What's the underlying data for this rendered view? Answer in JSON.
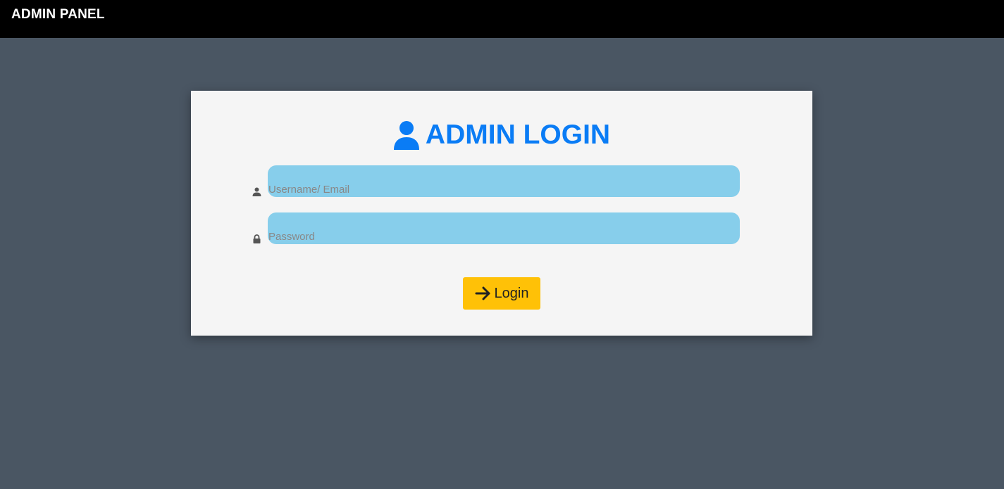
{
  "header": {
    "title": "ADMIN PANEL"
  },
  "login": {
    "heading": "ADMIN LOGIN",
    "heading_icon": "user-icon",
    "username": {
      "icon": "user-icon",
      "placeholder": "Username/ Email",
      "value": ""
    },
    "password": {
      "icon": "lock-icon",
      "placeholder": "Password",
      "value": ""
    },
    "button": {
      "icon": "arrow-right-icon",
      "label": "Login"
    }
  },
  "colors": {
    "background": "#4a5663",
    "topbar": "#000000",
    "card": "#f5f5f5",
    "accent": "#0a7cf5",
    "field": "#87ceeb",
    "button": "#ffc107"
  }
}
